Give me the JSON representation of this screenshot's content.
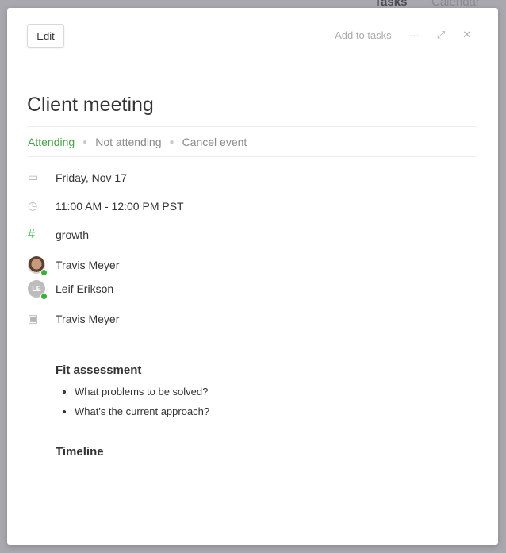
{
  "background": {
    "tabs": [
      "Tasks",
      "Calendar"
    ]
  },
  "toolbar": {
    "edit": "Edit",
    "add_to_tasks": "Add to tasks",
    "more_icon": "ellipsis-icon",
    "expand_icon": "expand-icon",
    "close_icon": "close-icon"
  },
  "event": {
    "title": "Client meeting",
    "rsvp": {
      "attending": "Attending",
      "not_attending": "Not attending",
      "cancel": "Cancel event"
    },
    "date": "Friday, Nov 17",
    "time": "11:00 AM - 12:00 PM PST",
    "channel": "growth",
    "attendees": [
      {
        "name": "Travis Meyer",
        "initials": "",
        "status": "online"
      },
      {
        "name": "Leif Erikson",
        "initials": "LE",
        "status": "online"
      }
    ],
    "organizer": "Travis Meyer"
  },
  "notes": {
    "sections": [
      {
        "heading": "Fit assessment",
        "bullets": [
          "What problems to be solved?",
          "What's the current approach?"
        ]
      },
      {
        "heading": "Timeline",
        "bullets": []
      }
    ]
  },
  "colors": {
    "attending": "#4aa24a",
    "status_online": "#3ab03a",
    "hash": "#5bc05b"
  }
}
